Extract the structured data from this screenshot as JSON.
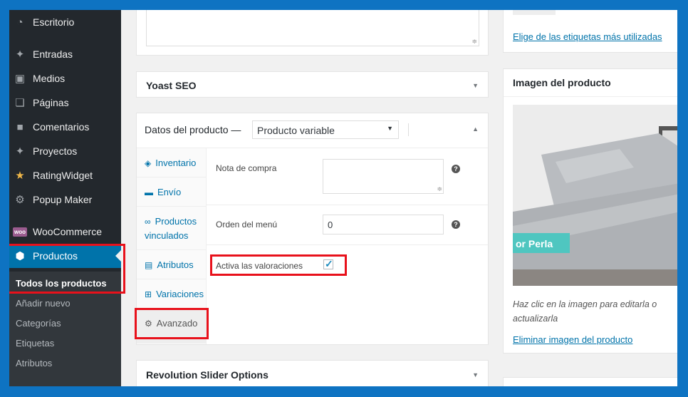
{
  "sidebar": {
    "items": [
      {
        "label": "Escritorio",
        "icon": "dashboard-icon"
      },
      {
        "label": "Entradas",
        "icon": "pushpin-icon"
      },
      {
        "label": "Medios",
        "icon": "media-icon"
      },
      {
        "label": "Páginas",
        "icon": "pages-icon"
      },
      {
        "label": "Comentarios",
        "icon": "comments-icon"
      },
      {
        "label": "Proyectos",
        "icon": "pushpin-icon"
      },
      {
        "label": "RatingWidget",
        "icon": "star-icon"
      },
      {
        "label": "Popup Maker",
        "icon": "gear-icon"
      },
      {
        "label": "WooCommerce",
        "icon": "woo-icon",
        "badge": "woo"
      },
      {
        "label": "Productos",
        "icon": "box-icon"
      }
    ],
    "submenu": [
      "Todos los productos",
      "Añadir nuevo",
      "Categorías",
      "Etiquetas",
      "Atributos"
    ]
  },
  "tags_panel": {
    "link": "Elige de las etiquetas más utilizadas"
  },
  "yoast": {
    "title": "Yoast SEO"
  },
  "product_data": {
    "title": "Datos del producto —",
    "type_select": "Producto variable",
    "tabs": [
      {
        "label": "Inventario",
        "icon": "tag-icon"
      },
      {
        "label": "Envío",
        "icon": "truck-icon"
      },
      {
        "label": "Productos vinculados",
        "icon": "link-icon"
      },
      {
        "label": "Atributos",
        "icon": "list-icon"
      },
      {
        "label": "Variaciones",
        "icon": "grid-icon"
      },
      {
        "label": "Avanzado",
        "icon": "gear-icon"
      }
    ],
    "purchase_note_label": "Nota de compra",
    "menu_order_label": "Orden del menú",
    "menu_order_value": "0",
    "reviews_label": "Activa las valoraciones",
    "reviews_checked": true
  },
  "revslider": {
    "title": "Revolution Slider Options"
  },
  "product_image": {
    "title": "Imagen del producto",
    "image_overlay": "or Perla",
    "hint": "Haz clic en la imagen para editarla o actualizarla",
    "remove_link": "Eliminar imagen del producto"
  },
  "colors": {
    "accent": "#0073aa",
    "highlight": "#e8111b",
    "frame": "#0e73c2"
  }
}
